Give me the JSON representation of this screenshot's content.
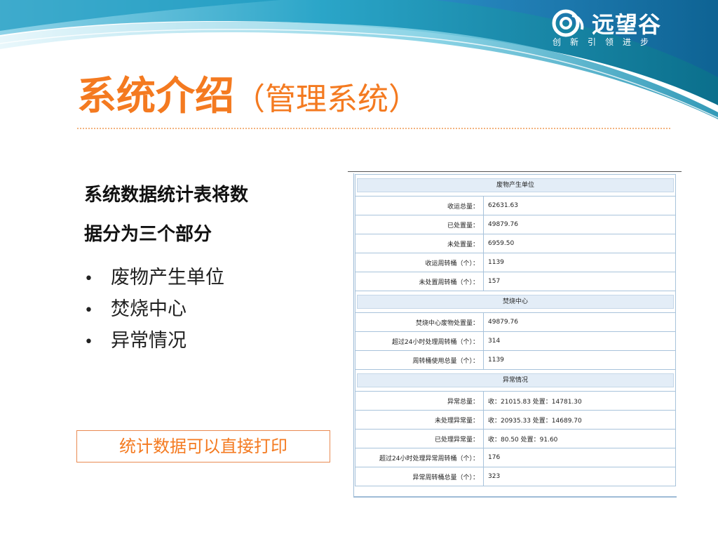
{
  "brand": {
    "logo_text": "远望谷",
    "slogan": "创新引领进步"
  },
  "title": {
    "main": "系统介绍",
    "sub": "（管理系统）"
  },
  "intro": {
    "line1": "系统数据统计表将数",
    "line2": "据分为三个部分"
  },
  "bullets": [
    {
      "marker": "•",
      "text": "废物产生单位"
    },
    {
      "marker": "•",
      "text": "焚烧中心"
    },
    {
      "marker": "•",
      "text": "异常情况"
    }
  ],
  "print_note": "统计数据可以直接打印",
  "stats_table": {
    "section1": {
      "header": "废物产生单位",
      "rows": [
        {
          "label": "收运总量：",
          "value": "62631.63"
        },
        {
          "label": "已处置量：",
          "value": "49879.76"
        },
        {
          "label": "未处置量：",
          "value": "6959.50"
        },
        {
          "label": "收运周转桶（个）：",
          "value": "1139"
        },
        {
          "label": "未处置周转桶（个）：",
          "value": "157"
        }
      ]
    },
    "section2": {
      "header": "焚烧中心",
      "rows": [
        {
          "label": "焚烧中心废物处置量：",
          "value": "49879.76"
        },
        {
          "label": "超过24小时处理周转桶（个）：",
          "value": "314"
        },
        {
          "label": "周转桶使用总量（个）：",
          "value": "1139"
        }
      ]
    },
    "section3": {
      "header": "异常情况",
      "rows": [
        {
          "label": "异常总量：",
          "value": "收：21015.83 处置：14781.30"
        },
        {
          "label": "未处理异常量：",
          "value": "收：20935.33 处置：14689.70"
        },
        {
          "label": "已处理异常量：",
          "value": "收：80.50 处置：91.60"
        },
        {
          "label": "超过24小时处理异常周转桶（个）：",
          "value": "176"
        },
        {
          "label": "异常周转桶总量（个）：",
          "value": "323"
        }
      ]
    }
  },
  "colors": {
    "title_orange": "#f47a20",
    "header_teal": "#0e7d94",
    "header_blue": "#1b6fb0"
  }
}
